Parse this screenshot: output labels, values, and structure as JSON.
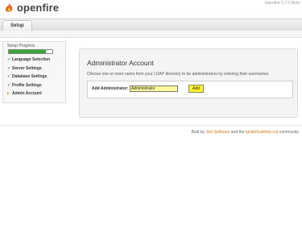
{
  "header": {
    "logo_text": "openfire",
    "version": "Openfire 3.7.0 Beta",
    "tabs": [
      {
        "label": "Setup"
      }
    ]
  },
  "sidebar": {
    "title": "Setup Progress",
    "progress_percent": 86,
    "items": [
      {
        "label": "Language Selection",
        "state": "done"
      },
      {
        "label": "Server Settings",
        "state": "done"
      },
      {
        "label": "Database Settings",
        "state": "done"
      },
      {
        "label": "Profile Settings",
        "state": "done"
      },
      {
        "label": "Admin Account",
        "state": "current"
      }
    ]
  },
  "main": {
    "title": "Administrator Account",
    "description": "Choose one or more users from your LDAP directory to be administrators by entering their usernames.",
    "form": {
      "label": "Add Administrator:",
      "input_value": "Administrator",
      "button_label": "Add"
    }
  },
  "footer": {
    "prefix": "Built by ",
    "link1": "Jive Software",
    "middle": " and the ",
    "link2": "IgniteRealtime.org",
    "suffix": " community"
  },
  "colors": {
    "accent_orange": "#e07b1a",
    "progress_green": "#3aa33a",
    "highlight_yellow": "#fff12a"
  }
}
